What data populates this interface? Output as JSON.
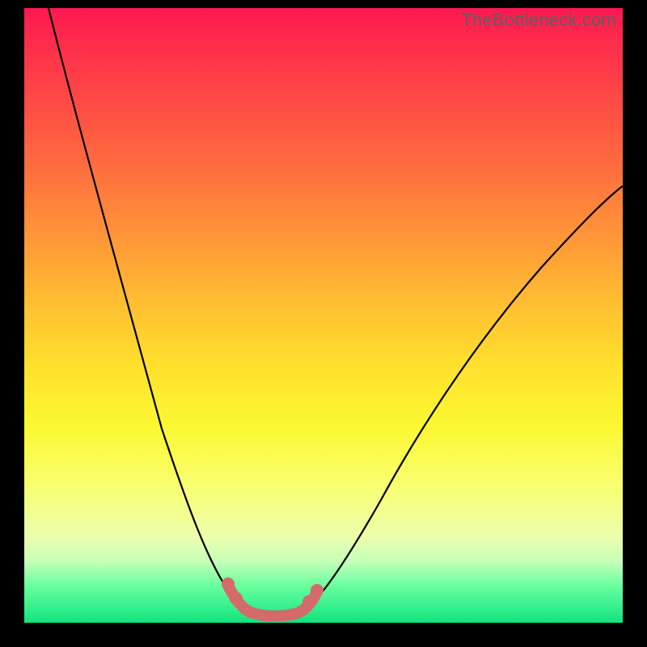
{
  "watermark": "TheBottleneck.com",
  "chart_data": {
    "type": "line",
    "title": "",
    "xlabel": "",
    "ylabel": "",
    "xlim": [
      0,
      100
    ],
    "ylim": [
      0,
      100
    ],
    "grid": false,
    "legend": false,
    "description": "V-shaped bottleneck curve on a rainbow gradient. Left branch descends from top-left to a flat minimum near x≈35–45, right branch rises toward upper-right. A pink marker highlights the minimum region.",
    "series": [
      {
        "name": "left-branch",
        "x": [
          4,
          8,
          12,
          16,
          20,
          24,
          28,
          30,
          32,
          34,
          36
        ],
        "y": [
          100,
          90,
          78,
          64,
          49,
          34,
          20,
          14,
          9,
          5,
          2
        ]
      },
      {
        "name": "right-branch",
        "x": [
          44,
          46,
          48,
          52,
          58,
          66,
          74,
          84,
          94,
          100
        ],
        "y": [
          2,
          4,
          7,
          13,
          22,
          33,
          43,
          53,
          62,
          67
        ]
      },
      {
        "name": "flat-minimum",
        "x": [
          36,
          38,
          40,
          42,
          44
        ],
        "y": [
          2,
          1,
          1,
          1,
          2
        ]
      }
    ],
    "highlight": {
      "name": "optimal-region",
      "x": [
        33,
        35,
        37,
        40,
        43,
        45,
        47
      ],
      "y": [
        6,
        3,
        1.5,
        1,
        1.5,
        3,
        6
      ],
      "marker_color": "#d46a6a"
    },
    "background_gradient": {
      "top": "#ff1850",
      "mid_upper": "#ff8a3a",
      "mid": "#ffe02d",
      "mid_lower": "#f8ff72",
      "bottom": "#10e47c"
    }
  }
}
